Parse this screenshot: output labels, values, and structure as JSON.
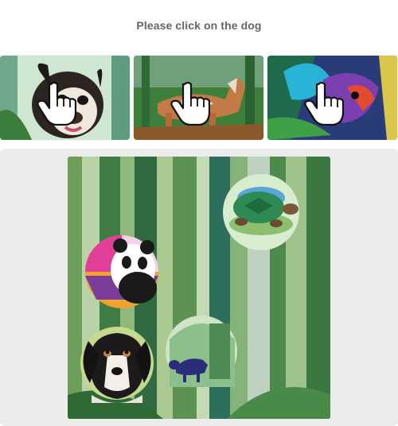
{
  "prompt": "Please click on the dog",
  "examples": [
    {
      "subject": "dog",
      "icon": "pointer-hand-icon"
    },
    {
      "subject": "dog",
      "icon": "pointer-hand-icon"
    },
    {
      "subject": "dog",
      "icon": "pointer-hand-icon"
    }
  ],
  "canvas": {
    "background": "watercolor-bamboo",
    "objects": [
      "turtle",
      "panda",
      "dog",
      "cow"
    ]
  },
  "colors": {
    "prompt_text": "#666666",
    "task_area_bg": "#ececec",
    "page_bg": "#ffffff"
  }
}
